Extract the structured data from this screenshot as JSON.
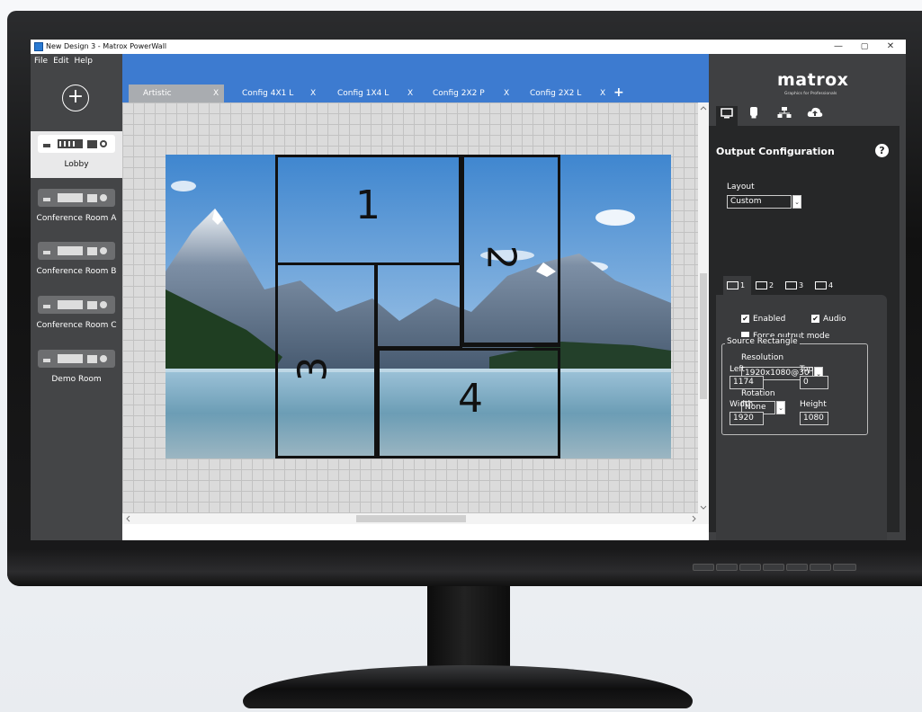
{
  "window": {
    "title": "New Design 3 - Matrox PowerWall",
    "min": "—",
    "max": "▢",
    "close": "✕"
  },
  "menu": {
    "file": "File",
    "edit": "Edit",
    "help": "Help"
  },
  "add_symbol": "+",
  "devices": [
    {
      "label": "Lobby",
      "selected": true
    },
    {
      "label": "Conference Room A",
      "selected": false
    },
    {
      "label": "Conference Room B",
      "selected": false
    },
    {
      "label": "Conference Room C",
      "selected": false
    },
    {
      "label": "Demo Room",
      "selected": false
    }
  ],
  "tabs": [
    {
      "label": "Artistic",
      "close": "X"
    },
    {
      "label": "Config 4X1 L",
      "close": "X"
    },
    {
      "label": "Config 1X4 L",
      "close": "X"
    },
    {
      "label": "Config 2X2 P",
      "close": "X"
    },
    {
      "label": "Config 2X2 L",
      "close": "X"
    }
  ],
  "add_tab_symbol": "+",
  "outputs_on_canvas": [
    "1",
    "2",
    "3",
    "4"
  ],
  "brand": {
    "logo": "matrox",
    "tagline": "Graphics for Professionals"
  },
  "panel": {
    "title": "Output Configuration",
    "help": "?",
    "layout_label": "Layout",
    "layout_value": "Custom",
    "output_tabs": [
      "1",
      "2",
      "3",
      "4"
    ],
    "enabled_label": "Enabled",
    "audio_label": "Audio",
    "force_label": "Force output mode",
    "resolution_label": "Resolution",
    "resolution_value": "1920x1080@30",
    "rotation_label": "Rotation",
    "rotation_value": "None",
    "source_rect_label": "Source Rectangle",
    "left_label": "Left",
    "left_value": "1174",
    "top_label": "Top",
    "top_value": "0",
    "width_label": "Width",
    "width_value": "1920",
    "height_label": "Height",
    "height_value": "1080"
  },
  "colors": {
    "accent": "#3d7bd0",
    "panel": "#3f4042",
    "sidebar": "#444547"
  }
}
